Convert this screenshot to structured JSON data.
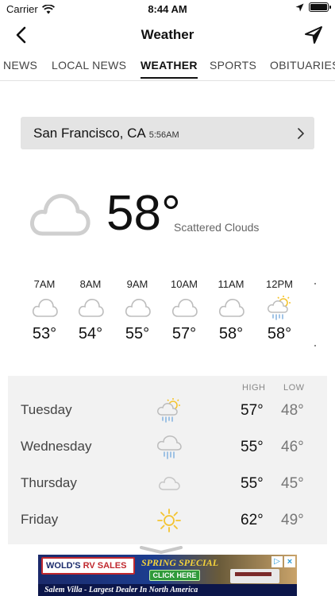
{
  "status_bar": {
    "carrier": "Carrier",
    "time": "8:44 AM",
    "icons": [
      "wifi-icon",
      "location-arrow-icon",
      "battery-icon"
    ]
  },
  "nav": {
    "title": "Weather",
    "back_icon": "chevron-left-icon",
    "locate_icon": "location-arrow-icon"
  },
  "tabs": [
    {
      "label": "NEWS",
      "active": false
    },
    {
      "label": "LOCAL NEWS",
      "active": false
    },
    {
      "label": "WEATHER",
      "active": true
    },
    {
      "label": "SPORTS",
      "active": false
    },
    {
      "label": "OBITUARIES",
      "active": false
    }
  ],
  "location": {
    "city": "San Francisco, CA",
    "time": "5:56AM"
  },
  "current": {
    "temp": "58°",
    "condition": "Scattered Clouds",
    "icon": "cloud-icon"
  },
  "hourly": [
    {
      "time": "7AM",
      "temp": "53°",
      "icon": "cloud-icon"
    },
    {
      "time": "8AM",
      "temp": "54°",
      "icon": "cloud-icon"
    },
    {
      "time": "9AM",
      "temp": "55°",
      "icon": "cloud-icon"
    },
    {
      "time": "10AM",
      "temp": "57°",
      "icon": "cloud-icon"
    },
    {
      "time": "11AM",
      "temp": "58°",
      "icon": "cloud-icon"
    },
    {
      "time": "12PM",
      "temp": "58°",
      "icon": "sun-rain-icon"
    }
  ],
  "daily": {
    "high_label": "HIGH",
    "low_label": "LOW",
    "days": [
      {
        "name": "Tuesday",
        "high": "57°",
        "low": "48°",
        "icon": "sun-rain-icon"
      },
      {
        "name": "Wednesday",
        "high": "55°",
        "low": "46°",
        "icon": "rain-icon"
      },
      {
        "name": "Thursday",
        "high": "55°",
        "low": "45°",
        "icon": "cloud-icon"
      },
      {
        "name": "Friday",
        "high": "62°",
        "low": "49°",
        "icon": "sun-icon"
      }
    ]
  },
  "ad": {
    "brand_prefix": "WOLD'S",
    "brand_rv": "RV SALES",
    "promo": "SPRING SPECIAL",
    "cta": "CLICK HERE",
    "tagline": "Salem Villa - Largest Dealer In North America",
    "close": "×"
  },
  "colors": {
    "tab_underline": "#111111",
    "location_bar": "#e4e4e4",
    "daily_panel": "#f2f2f2",
    "cloud_stroke": "#cfcfcf",
    "sun": "#f4c430",
    "rain": "#8ab6e0"
  }
}
